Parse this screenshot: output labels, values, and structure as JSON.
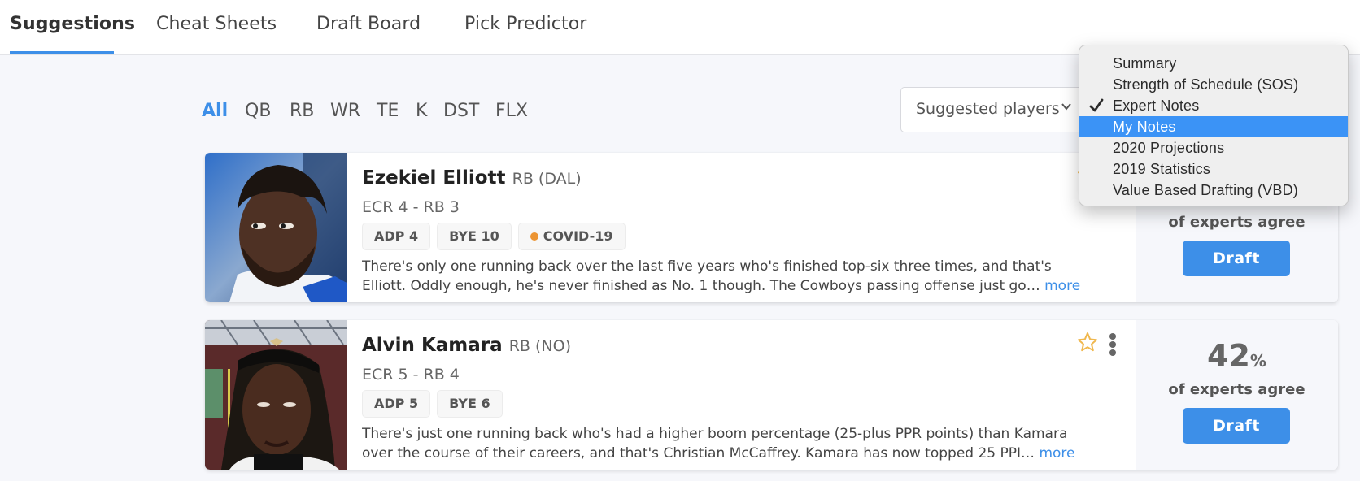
{
  "tabs": [
    {
      "label": "Suggestions",
      "active": true
    },
    {
      "label": "Cheat Sheets",
      "active": false
    },
    {
      "label": "Draft Board",
      "active": false
    },
    {
      "label": "Pick Predictor",
      "active": false
    }
  ],
  "position_filters": [
    {
      "label": "All",
      "active": true
    },
    {
      "label": "QB",
      "active": false
    },
    {
      "label": "RB",
      "active": false
    },
    {
      "label": "WR",
      "active": false
    },
    {
      "label": "TE",
      "active": false
    },
    {
      "label": "K",
      "active": false
    },
    {
      "label": "DST",
      "active": false
    },
    {
      "label": "FLX",
      "active": false
    }
  ],
  "player_select": {
    "value": "Suggested players",
    "icon": "chevron-down-icon"
  },
  "view_menu": {
    "items": [
      {
        "label": "Summary",
        "checked": false,
        "highlighted": false
      },
      {
        "label": "Strength of Schedule (SOS)",
        "checked": false,
        "highlighted": false
      },
      {
        "label": "Expert Notes",
        "checked": true,
        "highlighted": false
      },
      {
        "label": "My Notes",
        "checked": false,
        "highlighted": true
      },
      {
        "label": "2020 Projections",
        "checked": false,
        "highlighted": false
      },
      {
        "label": "2019 Statistics",
        "checked": false,
        "highlighted": false
      },
      {
        "label": "Value Based Drafting (VBD)",
        "checked": false,
        "highlighted": false
      }
    ]
  },
  "players": [
    {
      "name": "Ezekiel Elliott",
      "position_team": "RB (DAL)",
      "ecr": "ECR 4 - RB 3",
      "badges": [
        {
          "label": "ADP 4",
          "dot": false
        },
        {
          "label": "BYE 10",
          "dot": false
        },
        {
          "label": "COVID-19",
          "dot": true,
          "dot_color": "#ec9432"
        }
      ],
      "note_line1": "There's only one running back over the last five years who's finished top-six three times, and that's",
      "note_line2": "Elliott. Oddly enough, he's never finished as No. 1 though. The Cowboys passing offense just go",
      "more_label": "more",
      "agree_pct": "",
      "agree_label": "of experts agree",
      "draft_label": "Draft"
    },
    {
      "name": "Alvin Kamara",
      "position_team": "RB (NO)",
      "ecr": "ECR 5 - RB 4",
      "badges": [
        {
          "label": "ADP 5",
          "dot": false
        },
        {
          "label": "BYE 6",
          "dot": false
        }
      ],
      "note_line1": "There's just one running back who's had a higher boom percentage (25-plus PPR points) than Kamara",
      "note_line2": "over the course of their careers, and that's Christian McCaffrey. Kamara has now topped 25 PPI",
      "more_label": "more",
      "agree_pct": "42",
      "agree_pct_sign": "%",
      "agree_label": "of experts agree",
      "draft_label": "Draft"
    }
  ],
  "colors": {
    "accent": "#3d8fe8",
    "menu_highlight": "#3b93f6",
    "star": "#f0b84f",
    "covid_dot": "#ec9432"
  }
}
